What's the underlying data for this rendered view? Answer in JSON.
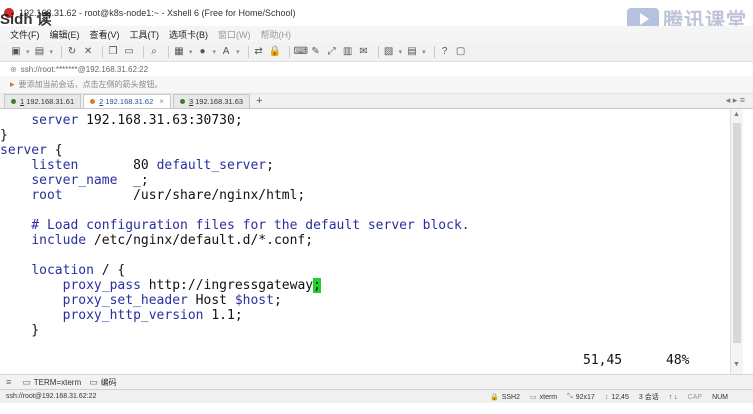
{
  "window": {
    "title": "192.168.31.62 - root@k8s-node1:~ - Xshell 6 (Free for Home/School)"
  },
  "watermark": {
    "text": "腾讯课堂",
    "icon": "play-icon"
  },
  "overlay": {
    "text": "Sidh    读"
  },
  "menu": [
    "文件(F)",
    "编辑(E)",
    "查看(V)",
    "工具(T)",
    "选项卡(B)",
    "窗口(W)",
    "帮助(H)"
  ],
  "address": {
    "text": "ssh://root:*******@192.168.31.62:22"
  },
  "infobar": {
    "text": "要添加当前会话，点击左侧的箭头按钮。"
  },
  "tabs": [
    {
      "num": "1",
      "label": "192.168.31.61",
      "dot": "#3a7d2a",
      "active": false
    },
    {
      "num": "2",
      "label": "192.168.31.62",
      "dot": "#d97f1a",
      "active": true
    },
    {
      "num": "3",
      "label": "192.168.31.63",
      "dot": "#3a7d2a",
      "active": false
    }
  ],
  "terminal": {
    "lines": [
      "    server 192.168.31.63:30730;",
      "}",
      "server {",
      "    listen       80 default_server;",
      "    server_name  _;",
      "    root         /usr/share/nginx/html;",
      "",
      "    # Load configuration files for the default server block.",
      "    include /etc/nginx/default.d/*.conf;",
      "",
      "    location / {",
      "        proxy_pass http://ingressgateway",
      "        proxy_set_header Host $host;",
      "        proxy_http_version 1.1;",
      "    }"
    ],
    "cursor_char": ";",
    "position": "51,45",
    "percent": "48%"
  },
  "bottom": {
    "term": "TERM=xterm",
    "encoding": "编码"
  },
  "status": {
    "connection": "ssh://root@192.168.31.62:22",
    "protocol": "SSH2",
    "terminal": "xterm",
    "size": "92x17",
    "cursor": "12,45",
    "sessions": "3 会话",
    "cap": "CAP",
    "num": "NUM"
  }
}
